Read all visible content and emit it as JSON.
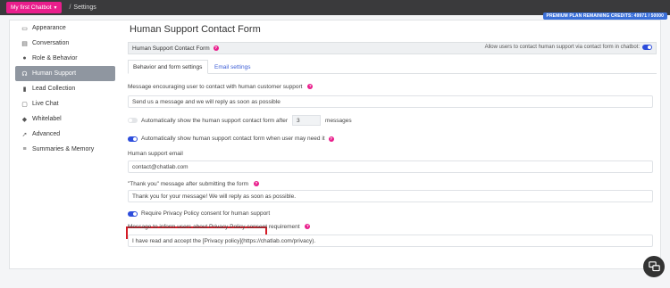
{
  "topbar": {
    "chatbot_label": "My first Chatbot",
    "separator": "/",
    "breadcrumb": "Settings",
    "plan_badge": "PREMIUM PLAN REMAINING CREDITS: 49971 / 50000"
  },
  "sidebar": {
    "items": [
      {
        "label": "Appearance",
        "icon": "monitor-icon"
      },
      {
        "label": "Conversation",
        "icon": "chat-bubbles-icon"
      },
      {
        "label": "Role & Behavior",
        "icon": "user-icon"
      },
      {
        "label": "Human Support",
        "icon": "headset-icon",
        "active": true
      },
      {
        "label": "Lead Collection",
        "icon": "address-book-icon"
      },
      {
        "label": "Live Chat",
        "icon": "chat-icon"
      },
      {
        "label": "Whitelabel",
        "icon": "tag-icon"
      },
      {
        "label": "Advanced",
        "icon": "rocket-icon"
      },
      {
        "label": "Summaries & Memory",
        "icon": "list-icon"
      }
    ]
  },
  "main": {
    "title": "Human Support Contact Form",
    "section_title": "Human Support Contact Form",
    "section_toggle_label": "Allow users to contact human support via contact form in chatbot:",
    "tabs": [
      {
        "label": "Behavior and form settings",
        "active": true
      },
      {
        "label": "Email settings",
        "active": false
      }
    ],
    "encourage_label": "Message encouraging user to contact with human customer support",
    "encourage_value": "Send us a message and we will reply as soon as possible",
    "auto_show_after_label": "Automatically show the human support contact form after",
    "auto_show_after_count": "3",
    "auto_show_after_suffix": "messages",
    "auto_show_need_label": "Automatically show human support contact form when user may need it",
    "email_label": "Human support email",
    "email_value": "contact@chatlab.com",
    "thanks_label": "\"Thank you\" message after submitting the form",
    "thanks_value": "Thank you for your message! We will reply as soon as possible.",
    "privacy_toggle_label": "Require Privacy Policy consent for human support",
    "privacy_msg_label": "Message to inform users about Privacy Policy consent requirement",
    "privacy_msg_value": "I have read and accept the [Privacy policy](https://chatlab.com/privacy)."
  },
  "colors": {
    "accent": "#e91e8c",
    "toggle_on": "#2d4ddc",
    "highlight": "#d41a25",
    "topbar": "#3a3a3c"
  }
}
